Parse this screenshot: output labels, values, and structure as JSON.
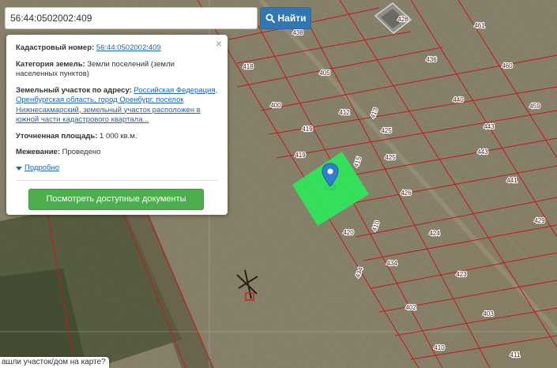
{
  "search": {
    "value": "56:44:0502002:409",
    "button_label": "Найти"
  },
  "popup": {
    "cadastral_label": "Кадастровый номер:",
    "cadastral_value": "56:44:0502002:409",
    "category_label": "Категория земель:",
    "category_value": "Земли поселений (земли населенных пунктов)",
    "address_label": "Земельный участок по адресу:",
    "address_value": "Российская Федерация, Оренбургская область, город Оренбург, поселок Нижнесакмарский, земельный участок расположен в южной части кадастрового квартала...",
    "area_label": "Уточненная площадь:",
    "area_value": "1 000 кв.м.",
    "survey_label": "Межевание:",
    "survey_value": "Проведено",
    "more_label": "Подробно",
    "docs_button": "Посмотреть доступные документы",
    "close_symbol": "×"
  },
  "bottom_hint": "ашли участок/дом на карте?",
  "plot_labels": [
    "438",
    "428",
    "461",
    "418",
    "405",
    "436",
    "460",
    "400",
    "412",
    "413",
    "440",
    "459",
    "419",
    "425",
    "443",
    "419",
    "415",
    "425",
    "443",
    "441",
    "426",
    "420",
    "410",
    "424",
    "429",
    "434",
    "423",
    "434",
    "402",
    "403",
    "410",
    "411"
  ],
  "colors": {
    "accent": "#3277b5",
    "selected_plot": "#2ee85a",
    "boundaries": "#c21a1a",
    "marker": "#2f7fd0",
    "docs_button": "#4cae4c"
  },
  "icons": {
    "search": "search-icon",
    "marker": "map-marker-icon",
    "close": "close-icon",
    "expand": "triangle-down-icon"
  }
}
